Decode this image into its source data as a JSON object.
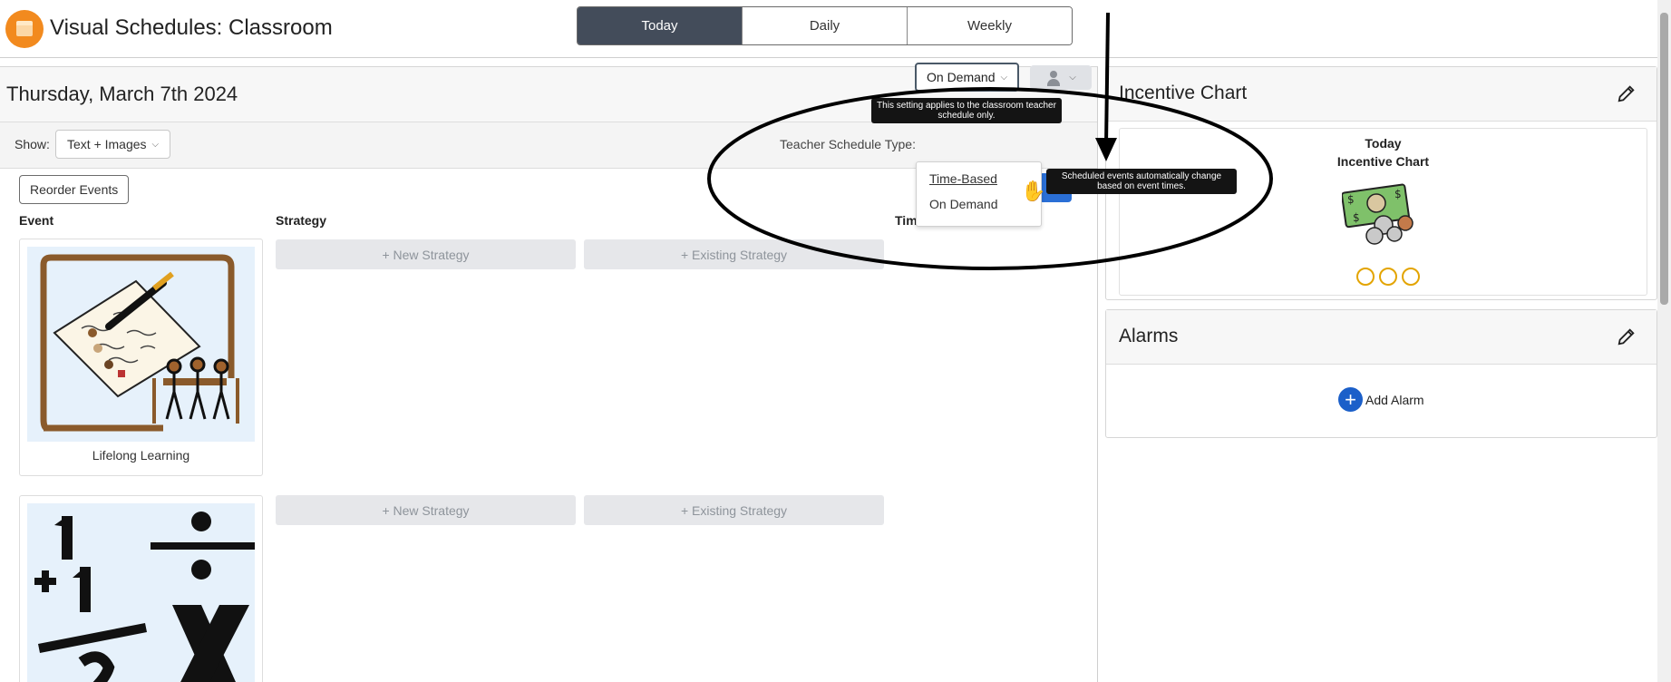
{
  "header": {
    "title": "Visual Schedules: Classroom",
    "tabs": [
      {
        "label": "Today",
        "active": true
      },
      {
        "label": "Daily",
        "active": false
      },
      {
        "label": "Weekly",
        "active": false
      }
    ]
  },
  "schedule": {
    "date": "Thursday, March 7th 2024",
    "show_label": "Show:",
    "show_value": "Text + Images",
    "teacher_schedule_type_label": "Teacher Schedule Type:",
    "teacher_schedule_type_value": "On Demand",
    "type_options": [
      "Time-Based",
      "On Demand"
    ],
    "tooltip_setting": "This setting applies to the classroom teacher schedule only.",
    "tooltip_time_based": "Scheduled events automatically change based on event times.",
    "reorder_label": "Reorder Events",
    "columns": {
      "event": "Event",
      "strategy": "Strategy",
      "timing": "Timi"
    },
    "events": [
      {
        "name": "Lifelong Learning",
        "new_strategy": "+ New Strategy",
        "existing_strategy": "+ Existing Strategy"
      },
      {
        "name": "",
        "new_strategy": "+ New Strategy",
        "existing_strategy": "+ Existing Strategy"
      }
    ]
  },
  "incentive": {
    "title": "Incentive Chart",
    "card_line1": "Today",
    "card_line2": "Incentive Chart",
    "tokens": 3
  },
  "alarms": {
    "title": "Alarms",
    "add_label": "Add Alarm"
  },
  "colors": {
    "active_tab": "#434c5a",
    "brand": "#f28a1e",
    "primary_blue": "#1b5fc9",
    "token": "#e3a400"
  }
}
